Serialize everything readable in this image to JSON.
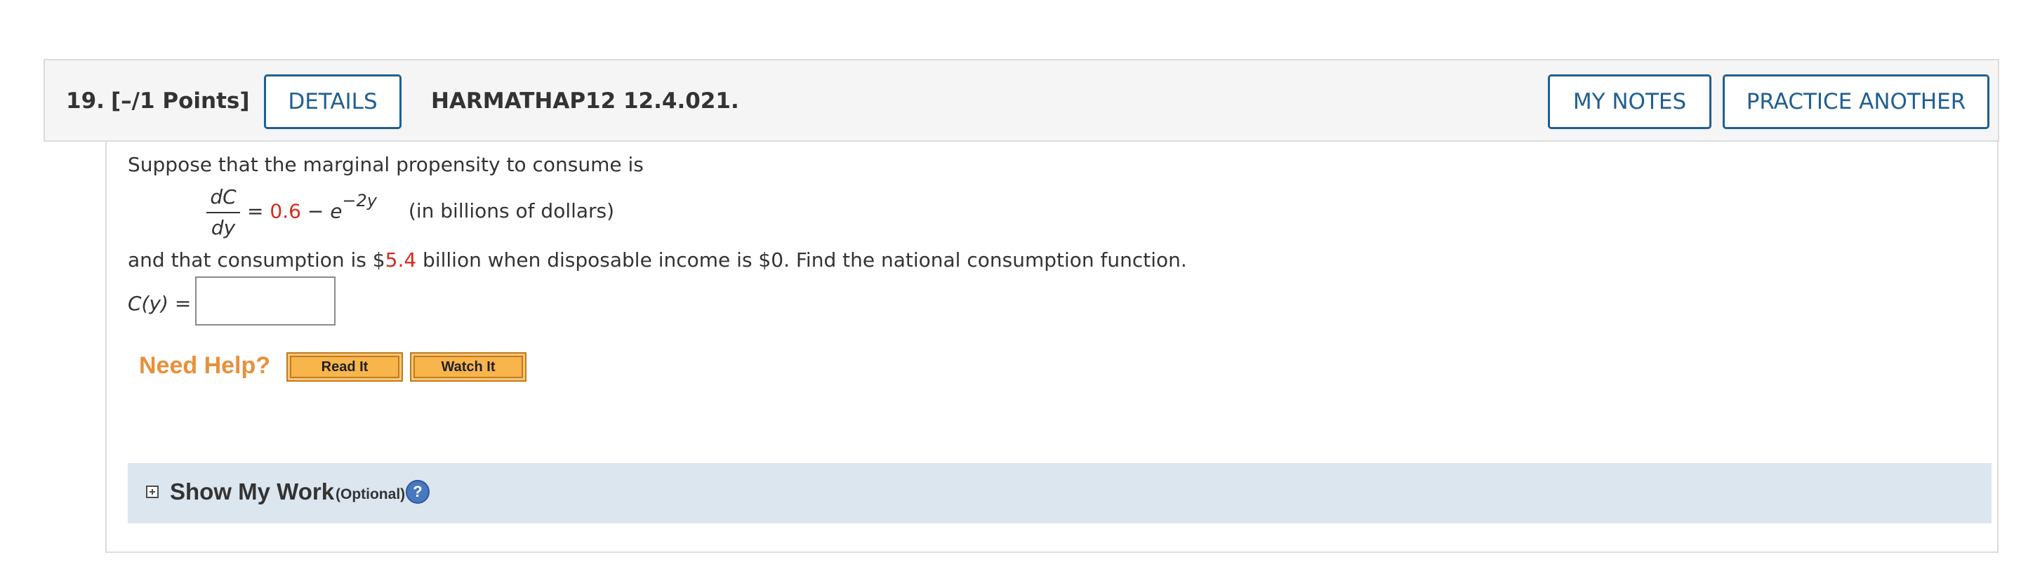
{
  "header": {
    "number": "19.",
    "points": "[–/1 Points]",
    "details_label": "DETAILS",
    "code": "HARMATHAP12 12.4.021.",
    "my_notes_label": "MY NOTES",
    "practice_label": "PRACTICE ANOTHER"
  },
  "problem": {
    "intro": "Suppose that the marginal propensity to consume is",
    "frac_num": "dC",
    "frac_den": "dy",
    "eq_equals": "=",
    "eq_value": "0.6",
    "eq_minus": "−",
    "eq_e": "e",
    "eq_exponent": "−2y",
    "eq_units": "(in billions of dollars)",
    "sentence_part1": "and that consumption is $",
    "sentence_value": "5.4",
    "sentence_part2": " billion when disposable income is $0. Find the national consumption function.",
    "answer_label": "C(y) =",
    "answer_value": ""
  },
  "help": {
    "need_help": "Need Help?",
    "read_it": "Read It",
    "watch_it": "Watch It"
  },
  "show_work": {
    "label": "Show My Work",
    "optional": "(Optional)",
    "help_icon_glyph": "?"
  },
  "colors": {
    "accent_blue": "#1f5f92",
    "value_red": "#d62a1e",
    "need_help_orange": "#e8903a",
    "showwork_bg": "#dce6ee"
  }
}
